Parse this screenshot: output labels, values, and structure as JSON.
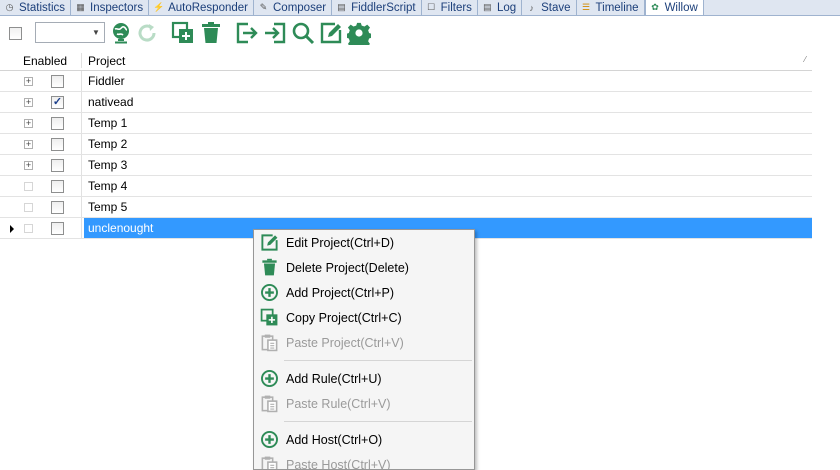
{
  "tabs": [
    {
      "label": "Statistics",
      "icon": "clock-icon"
    },
    {
      "label": "Inspectors",
      "icon": "inspector-icon"
    },
    {
      "label": "AutoResponder",
      "icon": "lightning-icon"
    },
    {
      "label": "Composer",
      "icon": "compose-icon"
    },
    {
      "label": "FiddlerScript",
      "icon": "script-icon"
    },
    {
      "label": "Filters",
      "icon": "filter-icon"
    },
    {
      "label": "Log",
      "icon": "log-icon"
    },
    {
      "label": "Stave",
      "icon": "music-icon"
    },
    {
      "label": "Timeline",
      "icon": "timeline-icon"
    },
    {
      "label": "Willow",
      "icon": "willow-icon",
      "active": true
    }
  ],
  "toolbar": {
    "combo_value": "",
    "buttons": [
      "globe-icon",
      "refresh-icon",
      "copy-icon",
      "trash-icon",
      "export-icon",
      "import-icon",
      "search-icon",
      "edit-icon",
      "gear-icon"
    ],
    "accent": "#2e8b57"
  },
  "grid": {
    "col_enabled": "Enabled",
    "col_project": "Project",
    "rows": [
      {
        "name": "Fiddler",
        "enabled": false,
        "expandable": true,
        "selected": false
      },
      {
        "name": "nativead",
        "enabled": true,
        "expandable": true,
        "selected": false
      },
      {
        "name": "Temp 1",
        "enabled": false,
        "expandable": true,
        "selected": false
      },
      {
        "name": "Temp 2",
        "enabled": false,
        "expandable": true,
        "selected": false
      },
      {
        "name": "Temp 3",
        "enabled": false,
        "expandable": true,
        "selected": false
      },
      {
        "name": "Temp 4",
        "enabled": false,
        "expandable": false,
        "selected": false
      },
      {
        "name": "Temp 5",
        "enabled": false,
        "expandable": false,
        "selected": false
      },
      {
        "name": "unclenought",
        "enabled": false,
        "expandable": false,
        "selected": true
      }
    ],
    "selection_color": "#3399ff"
  },
  "context_menu": {
    "items": [
      {
        "label": "Edit Project(Ctrl+D)",
        "icon": "edit-icon",
        "enabled": true
      },
      {
        "label": "Delete Project(Delete)",
        "icon": "trash-icon",
        "enabled": true
      },
      {
        "label": "Add Project(Ctrl+P)",
        "icon": "plus-circle-icon",
        "enabled": true
      },
      {
        "label": "Copy Project(Ctrl+C)",
        "icon": "copy-icon",
        "enabled": true
      },
      {
        "label": "Paste Project(Ctrl+V)",
        "icon": "paste-icon",
        "enabled": false
      },
      {
        "separator": true
      },
      {
        "label": "Add Rule(Ctrl+U)",
        "icon": "plus-circle-icon",
        "enabled": true
      },
      {
        "label": "Paste Rule(Ctrl+V)",
        "icon": "paste-icon",
        "enabled": false
      },
      {
        "separator": true
      },
      {
        "label": "Add Host(Ctrl+O)",
        "icon": "plus-circle-icon",
        "enabled": true
      },
      {
        "label": "Paste Host(Ctrl+V)",
        "icon": "paste-icon",
        "enabled": false
      }
    ]
  }
}
